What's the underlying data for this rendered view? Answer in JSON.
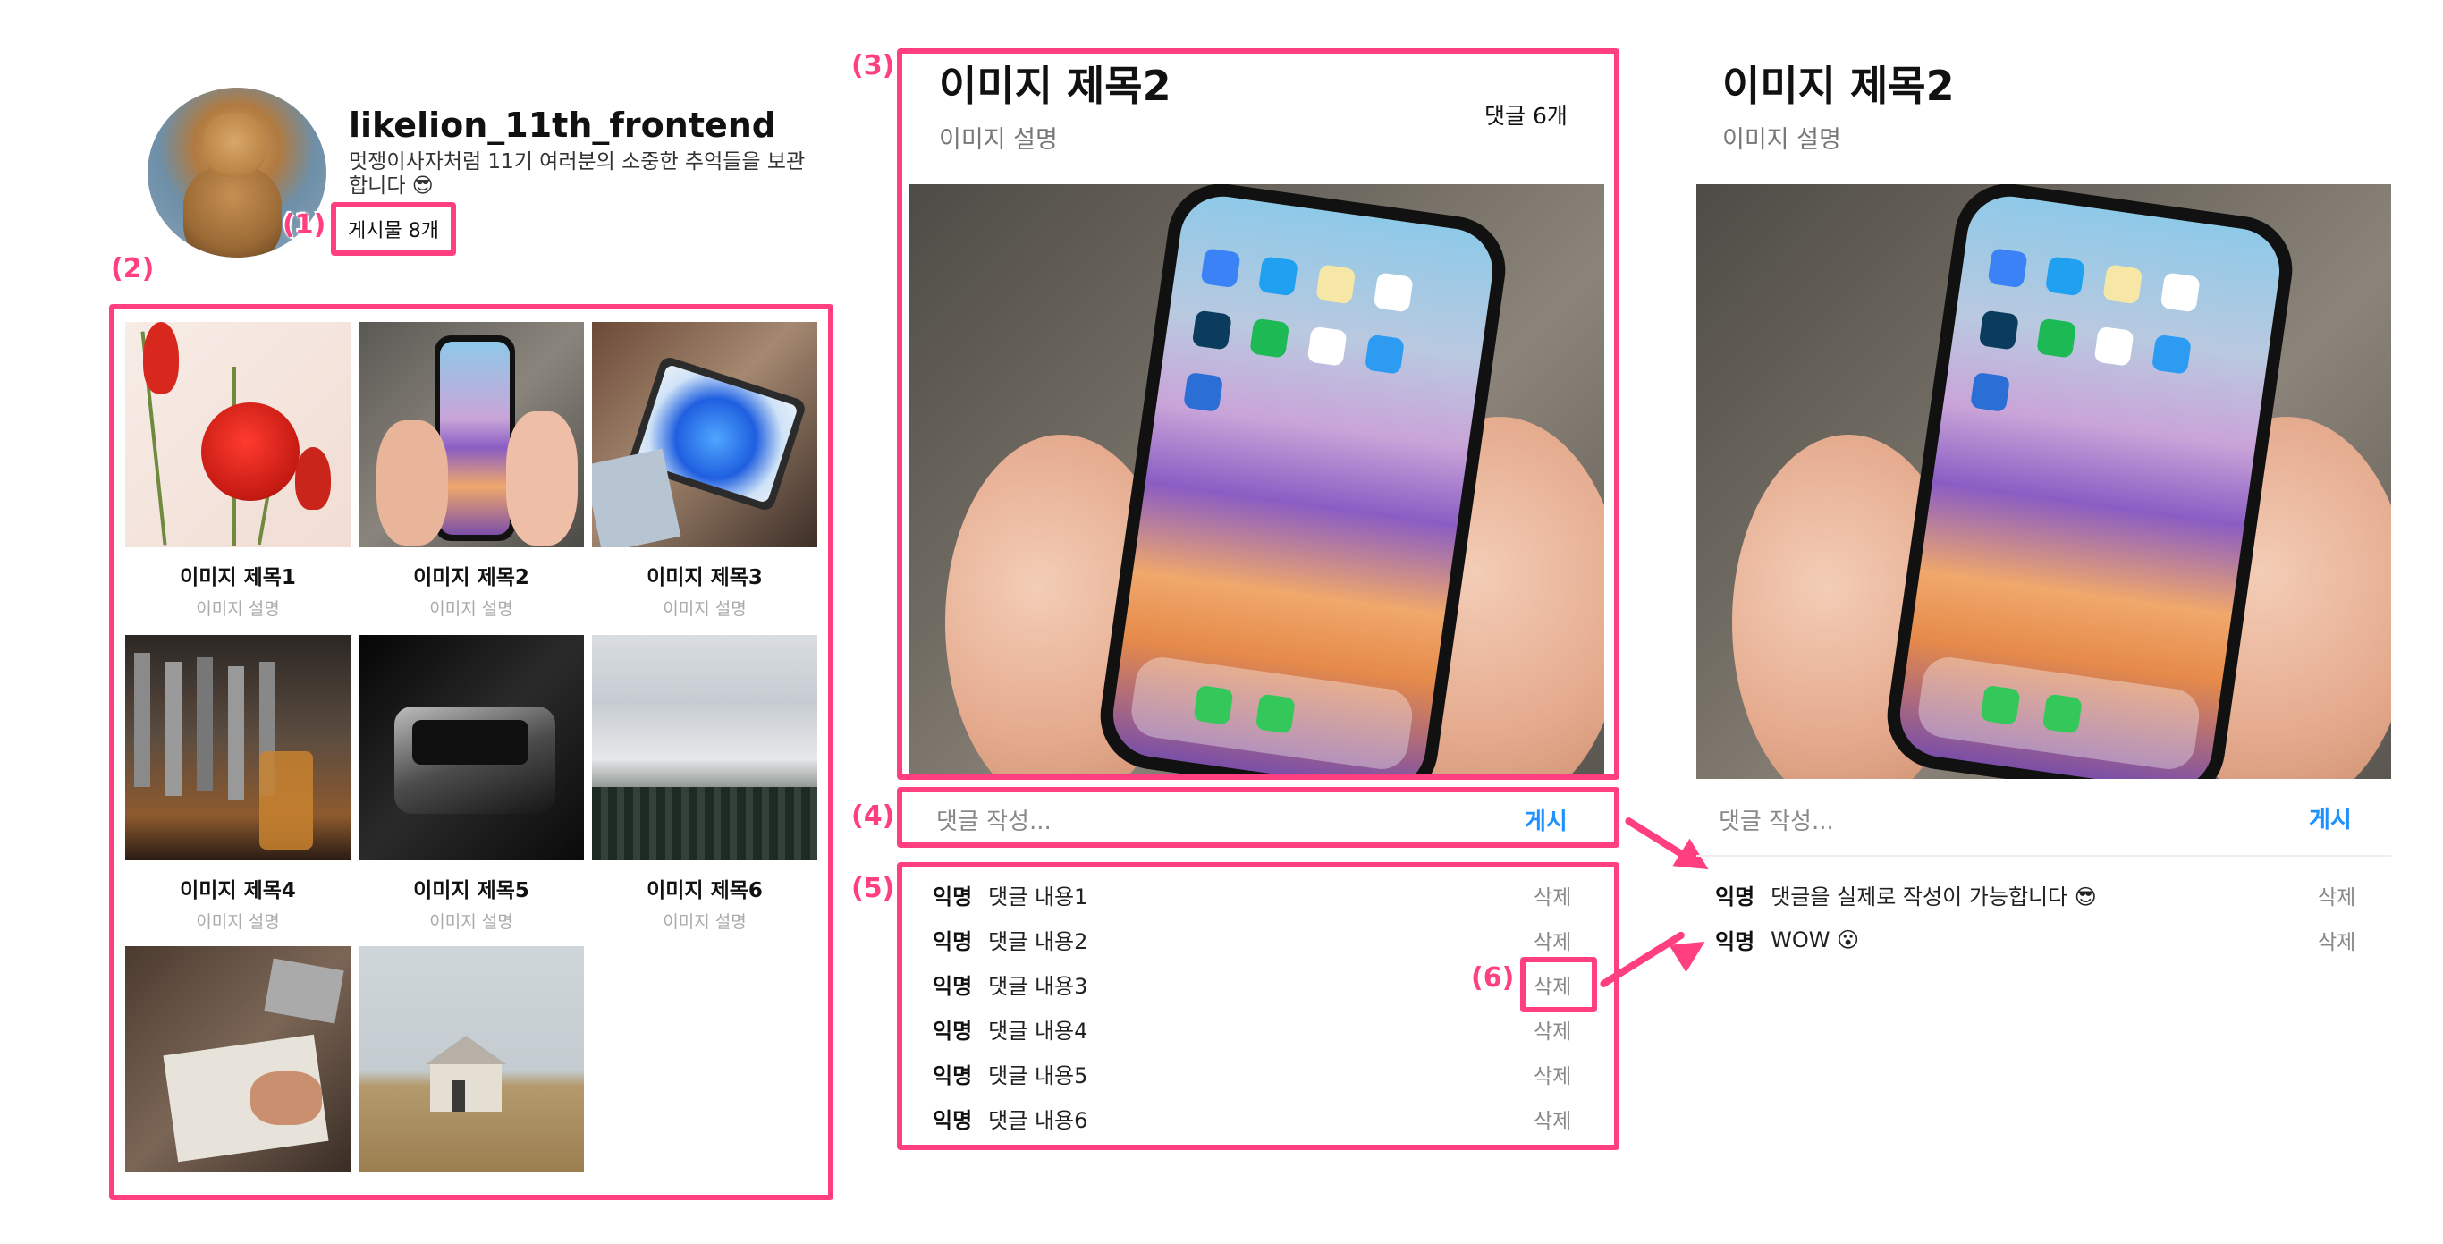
{
  "profile": {
    "username": "likelion_11th_frontend",
    "bio": "멋쟁이사자처럼 11기 여러분의 소중한 추억들을 보관합니다 😎",
    "post_count": "게시물 8개"
  },
  "annotations": [
    "(1)",
    "(2)",
    "(3)",
    "(4)",
    "(5)",
    "(6)"
  ],
  "grid": [
    {
      "title": "이미지 제목1",
      "desc": "이미지 설명",
      "icon": "tulip-photo"
    },
    {
      "title": "이미지 제목2",
      "desc": "이미지 설명",
      "icon": "phone-photo"
    },
    {
      "title": "이미지 제목3",
      "desc": "이미지 설명",
      "icon": "tablet-photo"
    },
    {
      "title": "이미지 제목4",
      "desc": "이미지 설명",
      "icon": "bar-taps-photo"
    },
    {
      "title": "이미지 제목5",
      "desc": "이미지 설명",
      "icon": "car-photo"
    },
    {
      "title": "이미지 제목6",
      "desc": "이미지 설명",
      "icon": "snowy-mountain-photo"
    },
    {
      "title": "",
      "desc": "",
      "icon": "drawing-desk-photo"
    },
    {
      "title": "",
      "desc": "",
      "icon": "farmhouse-photo"
    }
  ],
  "detail": {
    "title": "이미지 제목2",
    "desc": "이미지 설명",
    "comment_count": "댓글 6개",
    "input_placeholder": "댓글 작성...",
    "post_label": "게시",
    "comments": [
      {
        "author": "익명",
        "text": "댓글 내용1",
        "delete": "삭제"
      },
      {
        "author": "익명",
        "text": "댓글 내용2",
        "delete": "삭제"
      },
      {
        "author": "익명",
        "text": "댓글 내용3",
        "delete": "삭제"
      },
      {
        "author": "익명",
        "text": "댓글 내용4",
        "delete": "삭제"
      },
      {
        "author": "익명",
        "text": "댓글 내용5",
        "delete": "삭제"
      },
      {
        "author": "익명",
        "text": "댓글 내용6",
        "delete": "삭제"
      }
    ]
  },
  "detail_after": {
    "title": "이미지 제목2",
    "desc": "이미지 설명",
    "input_placeholder": "댓글 작성...",
    "post_label": "게시",
    "comments": [
      {
        "author": "익명",
        "text": "댓글을 실제로 작성이 가능합니다 😎",
        "delete": "삭제"
      },
      {
        "author": "익명",
        "text": "WOW 😮",
        "delete": "삭제"
      }
    ]
  },
  "colors": {
    "annotation": "#ff3f7f",
    "post_button": "#1e90ff",
    "muted_text": "#888888"
  }
}
